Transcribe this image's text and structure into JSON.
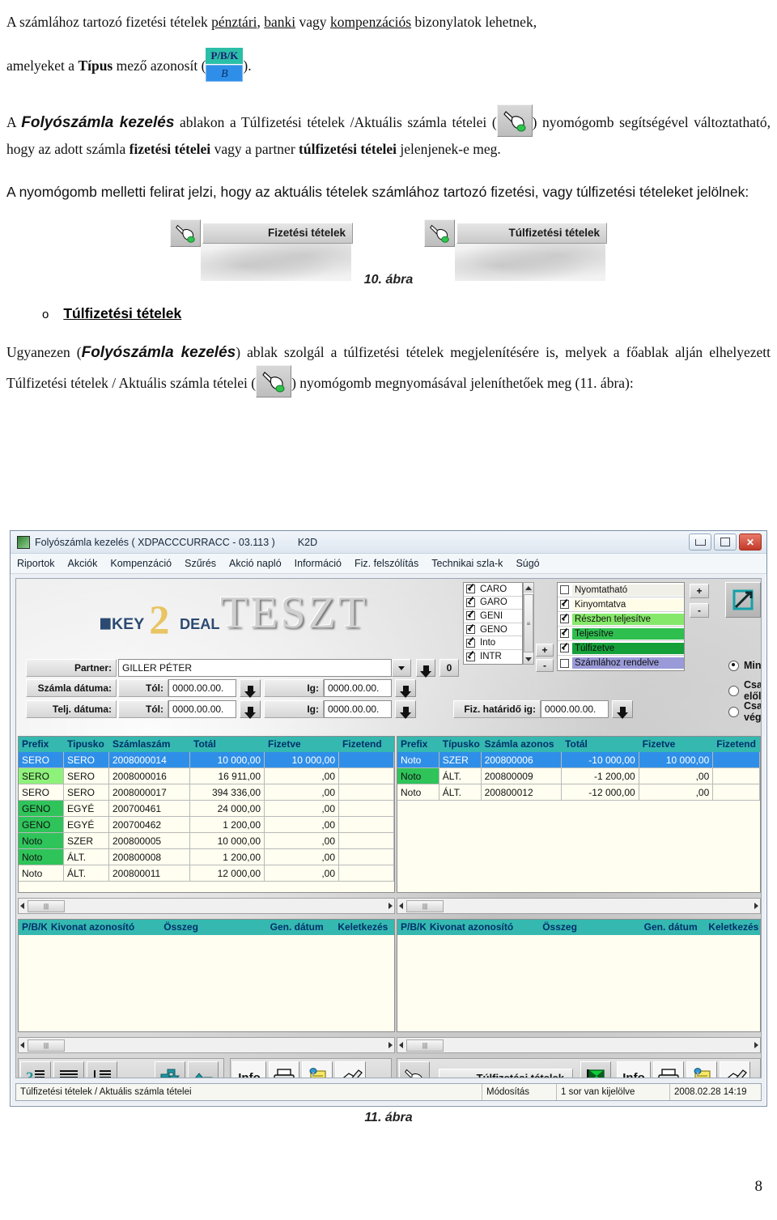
{
  "document": {
    "para1_before": "A számlához tartozó fizetési tételek ",
    "para1_u1": "pénztári",
    "para1_mid1": ", ",
    "para1_u2": "banki",
    "para1_mid2": " vagy ",
    "para1_u3": "kompenzációs",
    "para1_after": " bizonylatok lehetnek,",
    "para1_line2_a": "amelyeket a ",
    "para1_line2_b": "Típus",
    "para1_line2_c": " mező azonosít (",
    "para1_line2_d": ").",
    "pbk_icon_header": "P/B/K",
    "pbk_icon_cell": "B",
    "para2_a": "A ",
    "para2_b": "Folyószámla kezelés",
    "para2_c": " ablakon a Túlfizetési tételek /Aktuális számla tételei (",
    "para2_d": ") nyomógomb segítségével változtatható, hogy az adott számla ",
    "para2_e": "fizetési tételei",
    "para2_f": " vagy a partner ",
    "para2_g": "túlfizetési tételei",
    "para2_h": " jelenjenek-e meg.",
    "para3": "A nyomógomb melletti felirat jelzi, hogy az aktuális tételek számlához tartozó fizetési, vagy túlfizetési tételeket jelölnek:",
    "fig10_label_left": "Fizetési tételek",
    "fig10_label_right": "Túlfizetési tételek",
    "fig10_caption": "10. ábra",
    "bullet_marker": "o",
    "bullet_label": "Túlfizetési tételek",
    "para4_a": "Ugyanezen (",
    "para4_b": "Folyószámla kezelés",
    "para4_c": ") ablak szolgál a túlfizetési tételek megjelenítésére is, melyek a főablak alján elhelyezett Túlfizetési tételek / Aktuális számla tételei (",
    "para4_d": ") nyomógomb megnyomásával jeleníthetőek meg (11. ábra):",
    "fig11_caption": "11. ábra",
    "page_number": "8"
  },
  "app": {
    "titlebar": {
      "title": "Folyószámla kezelés ( XDPACCCURRACC - 03.113 )",
      "module": "K2D",
      "minimize_label": "",
      "maximize_label": "",
      "close_label": "✕"
    },
    "menu": [
      "Riportok",
      "Akciók",
      "Kompenzáció",
      "Szűrés",
      "Akció napló",
      "Információ",
      "Fiz. felszólítás",
      "Technikai szla-k",
      "Súgó"
    ],
    "branding": {
      "logo_key": "KEY",
      "logo_two": "2",
      "logo_deal": "DEAL",
      "watermark": "TESZT"
    },
    "form": {
      "partner_label": "Partner:",
      "partner_value": "GILLER PÉTER",
      "partner_count": "0",
      "invoice_date_label": "Számla dátuma:",
      "completion_date_label": "Telj. dátuma:",
      "from_label": "Tól:",
      "to_label": "Ig:",
      "invoice_date_from": "0000.00.00.",
      "invoice_date_to": "0000.00.00.",
      "completion_date_from": "0000.00.00.",
      "completion_date_to": "0000.00.00.",
      "payment_deadline_label": "Fiz. határidő ig:",
      "payment_deadline_value": "0000.00.00."
    },
    "type_list": [
      {
        "label": "CARO",
        "checked": true
      },
      {
        "label": "GARO",
        "checked": true
      },
      {
        "label": "GENI",
        "checked": true
      },
      {
        "label": "GENO",
        "checked": true
      },
      {
        "label": "Into",
        "checked": true
      },
      {
        "label": "INTR",
        "checked": true
      }
    ],
    "status_list": [
      {
        "label": "Nyomtatható",
        "checked": false,
        "color": "#f0f0e8"
      },
      {
        "label": "Kinyomtatva",
        "checked": true,
        "color": "#fffde8"
      },
      {
        "label": "Részben teljesítve",
        "checked": true,
        "color": "#86e86a"
      },
      {
        "label": "Teljesítve",
        "checked": true,
        "color": "#2fbf4f"
      },
      {
        "label": "Túlfizetve",
        "checked": true,
        "color": "#15a03a"
      },
      {
        "label": "Számlához rendelve",
        "checked": false,
        "color": "#9a9ad8"
      }
    ],
    "plus_label": "+",
    "minus_label": "-",
    "radios": [
      {
        "label": "Mind",
        "selected": true
      },
      {
        "label": "Csak előleg",
        "selected": false
      },
      {
        "label": "Csak végszla",
        "selected": false
      }
    ],
    "left_grid": {
      "columns": [
        "Prefix",
        "Tipusko",
        "Számlaszám",
        "Totál",
        "Fizetve",
        "Fizetend"
      ],
      "rows": [
        {
          "cells": [
            "SERO",
            "SERO",
            "2008000014",
            "10 000,00",
            "10 000,00",
            ""
          ],
          "selected": true,
          "prefix_color": ""
        },
        {
          "cells": [
            "SERO",
            "SERO",
            "2008000016",
            "16 911,00",
            ",00",
            ""
          ],
          "selected": false,
          "prefix_color": "#8ef27a"
        },
        {
          "cells": [
            "SERO",
            "SERO",
            "2008000017",
            "394 336,00",
            ",00",
            ""
          ],
          "selected": false,
          "prefix_color": ""
        },
        {
          "cells": [
            "GENO",
            "EGYÉ",
            "200700461",
            "24 000,00",
            ",00",
            ""
          ],
          "selected": false,
          "prefix_color": "#2fc45a"
        },
        {
          "cells": [
            "GENO",
            "EGYÉ",
            "200700462",
            "1 200,00",
            ",00",
            ""
          ],
          "selected": false,
          "prefix_color": "#2fc45a"
        },
        {
          "cells": [
            "Noto",
            "SZER",
            "200800005",
            "10 000,00",
            ",00",
            ""
          ],
          "selected": false,
          "prefix_color": "#2fc45a"
        },
        {
          "cells": [
            "Noto",
            "ÁLT.",
            "200800008",
            "1 200,00",
            ",00",
            ""
          ],
          "selected": false,
          "prefix_color": "#2fc45a"
        },
        {
          "cells": [
            "Noto",
            "ÁLT.",
            "200800011",
            "12 000,00",
            ",00",
            ""
          ],
          "selected": false,
          "prefix_color": ""
        }
      ]
    },
    "right_grid": {
      "columns": [
        "Prefix",
        "Típusko",
        "Számla azonos",
        "Totál",
        "Fizetve",
        "Fizetend"
      ],
      "rows": [
        {
          "cells": [
            "Noto",
            "SZER",
            "200800006",
            "-10 000,00",
            "10 000,00",
            ""
          ],
          "selected": true,
          "prefix_color": ""
        },
        {
          "cells": [
            "Noto",
            "ÁLT.",
            "200800009",
            "-1 200,00",
            ",00",
            ""
          ],
          "selected": false,
          "prefix_color": "#2fc45a"
        },
        {
          "cells": [
            "Noto",
            "ÁLT.",
            "200800012",
            "-12 000,00",
            ",00",
            ""
          ],
          "selected": false,
          "prefix_color": ""
        }
      ]
    },
    "detail_grid_columns": [
      "P/B/K",
      "Kivonat azonosító",
      "Összeg",
      "Gen. dátum",
      "Keletkezés"
    ],
    "toolbar": {
      "overpayment_button_label": "Túlfizetési tételek",
      "info_label": "Info"
    },
    "statusbar": {
      "context": "Túlfizetési tételek / Aktuális számla tételei",
      "mode": "Módosítás",
      "selection": "1 sor van kijelölve",
      "timestamp": "2008.02.28 14:19"
    }
  },
  "colors": {
    "grid_header": "#35b8b0",
    "selection": "#2f8fe8",
    "grid_bg": "#fffef0"
  }
}
